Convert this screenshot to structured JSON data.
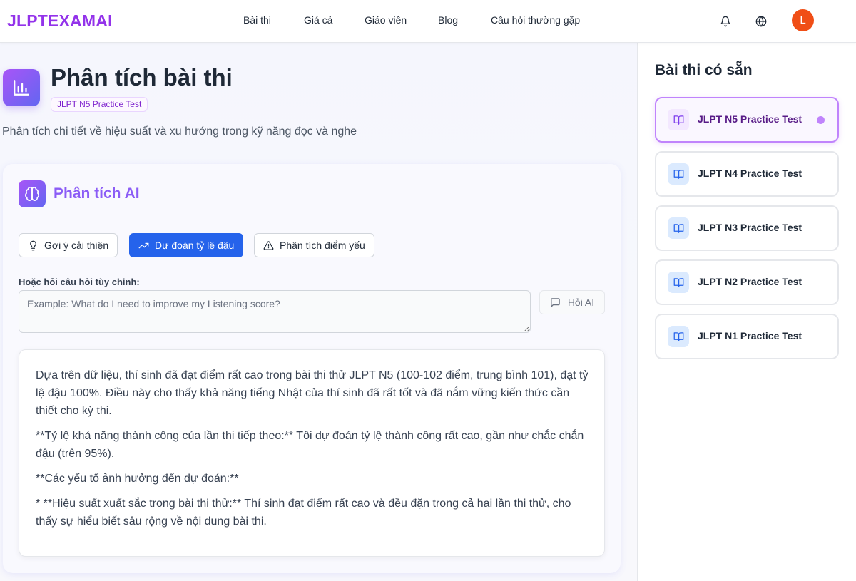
{
  "header": {
    "logo": "JLPTEXAMAI",
    "nav": [
      "Bài thi",
      "Giá cả",
      "Giáo viên",
      "Blog",
      "Câu hỏi thường gặp"
    ],
    "avatar_letter": "L"
  },
  "page": {
    "title": "Phân tích bài thi",
    "badge": "JLPT N5 Practice Test",
    "subtitle": "Phân tích chi tiết về hiệu suất và xu hướng trong kỹ năng đọc và nghe"
  },
  "ai": {
    "title": "Phân tích AI",
    "chips": [
      "Gợi ý cải thiện",
      "Dự đoán tỷ lệ đậu",
      "Phân tích điểm yếu"
    ],
    "active_chip": "Dự đoán tỷ lệ đậu",
    "ask_label": "Hoặc hỏi câu hỏi tùy chỉnh:",
    "ask_placeholder": "Example: What do I need to improve my Listening score?",
    "ask_button": "Hỏi AI",
    "answer": [
      "Dựa trên dữ liệu, thí sinh đã đạt điểm rất cao trong bài thi thử JLPT N5 (100-102 điểm, trung bình 101), đạt tỷ lệ đậu 100%. Điều này cho thấy khả năng tiếng Nhật của thí sinh đã rất tốt và đã nắm vững kiến thức cần thiết cho kỳ thi.",
      "**Tỷ lệ khả năng thành công của lần thi tiếp theo:** Tôi dự đoán tỷ lệ thành công rất cao, gần như chắc chắn đậu (trên 95%).",
      "**Các yếu tố ảnh hưởng đến dự đoán:**",
      "* **Hiệu suất xuất sắc trong bài thi thử:** Thí sinh đạt điểm rất cao và đều đặn trong cả hai lần thi thử, cho thấy sự hiểu biết sâu rộng về nội dung bài thi."
    ]
  },
  "sidebar": {
    "title": "Bài thi có sẵn",
    "tests": [
      "JLPT N5 Practice Test",
      "JLPT N4 Practice Test",
      "JLPT N3 Practice Test",
      "JLPT N2 Practice Test",
      "JLPT N1 Practice Test"
    ],
    "active_test": "JLPT N5 Practice Test"
  },
  "colors": {
    "brand": "#9333ea",
    "primary": "#2563eb",
    "avatar": "#f04e16"
  }
}
